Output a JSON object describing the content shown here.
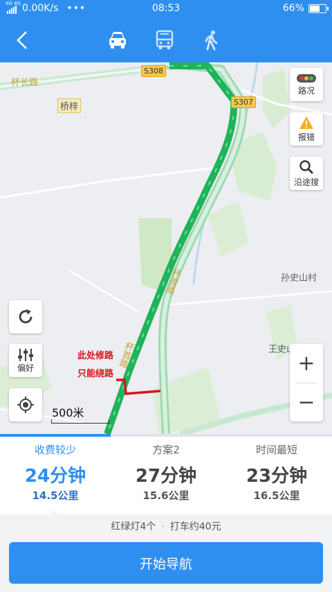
{
  "status_bar": {
    "network": "4G 4G",
    "speed": "0.00K/s",
    "dots": "•••",
    "time": "08:53",
    "battery_text": "66%",
    "battery_level": 0.66
  },
  "header": {
    "modes": [
      {
        "name": "car-icon",
        "active": true
      },
      {
        "name": "bus-icon",
        "active": false
      },
      {
        "name": "walk-icon",
        "active": false
      }
    ]
  },
  "map": {
    "road_labels": {
      "road_west": "杯长路",
      "road_main": "杯首路",
      "road_east": "杯首路"
    },
    "place_labels": {
      "qiaozi": "桥梓",
      "sunshishan": "孙史山村",
      "wangshi": "王史山村"
    },
    "shields": {
      "s308": "S308",
      "s307": "S307"
    },
    "annotation": {
      "line1": "此处修路",
      "line2": "只能绕路"
    },
    "scale": "500米",
    "tools": {
      "traffic": "路况",
      "report": "报错",
      "search_along": "沿途搜",
      "preference": "偏好"
    },
    "zoom": {
      "in": "+",
      "out": "−"
    }
  },
  "routes": [
    {
      "tag": "收费较少",
      "time": "24分钟",
      "distance": "14.5公里",
      "selected": true
    },
    {
      "tag": "方案2",
      "time": "27分钟",
      "distance": "15.6公里",
      "selected": false
    },
    {
      "tag": "时间最短",
      "time": "23分钟",
      "distance": "16.5公里",
      "selected": false
    }
  ],
  "info": {
    "lights": "红绿灯4个",
    "taxi": "打车约40元"
  },
  "start_button": "开始导航",
  "colors": {
    "accent": "#2f8ff0",
    "route_green": "#1fb35a",
    "warn_red": "#d8141c"
  }
}
